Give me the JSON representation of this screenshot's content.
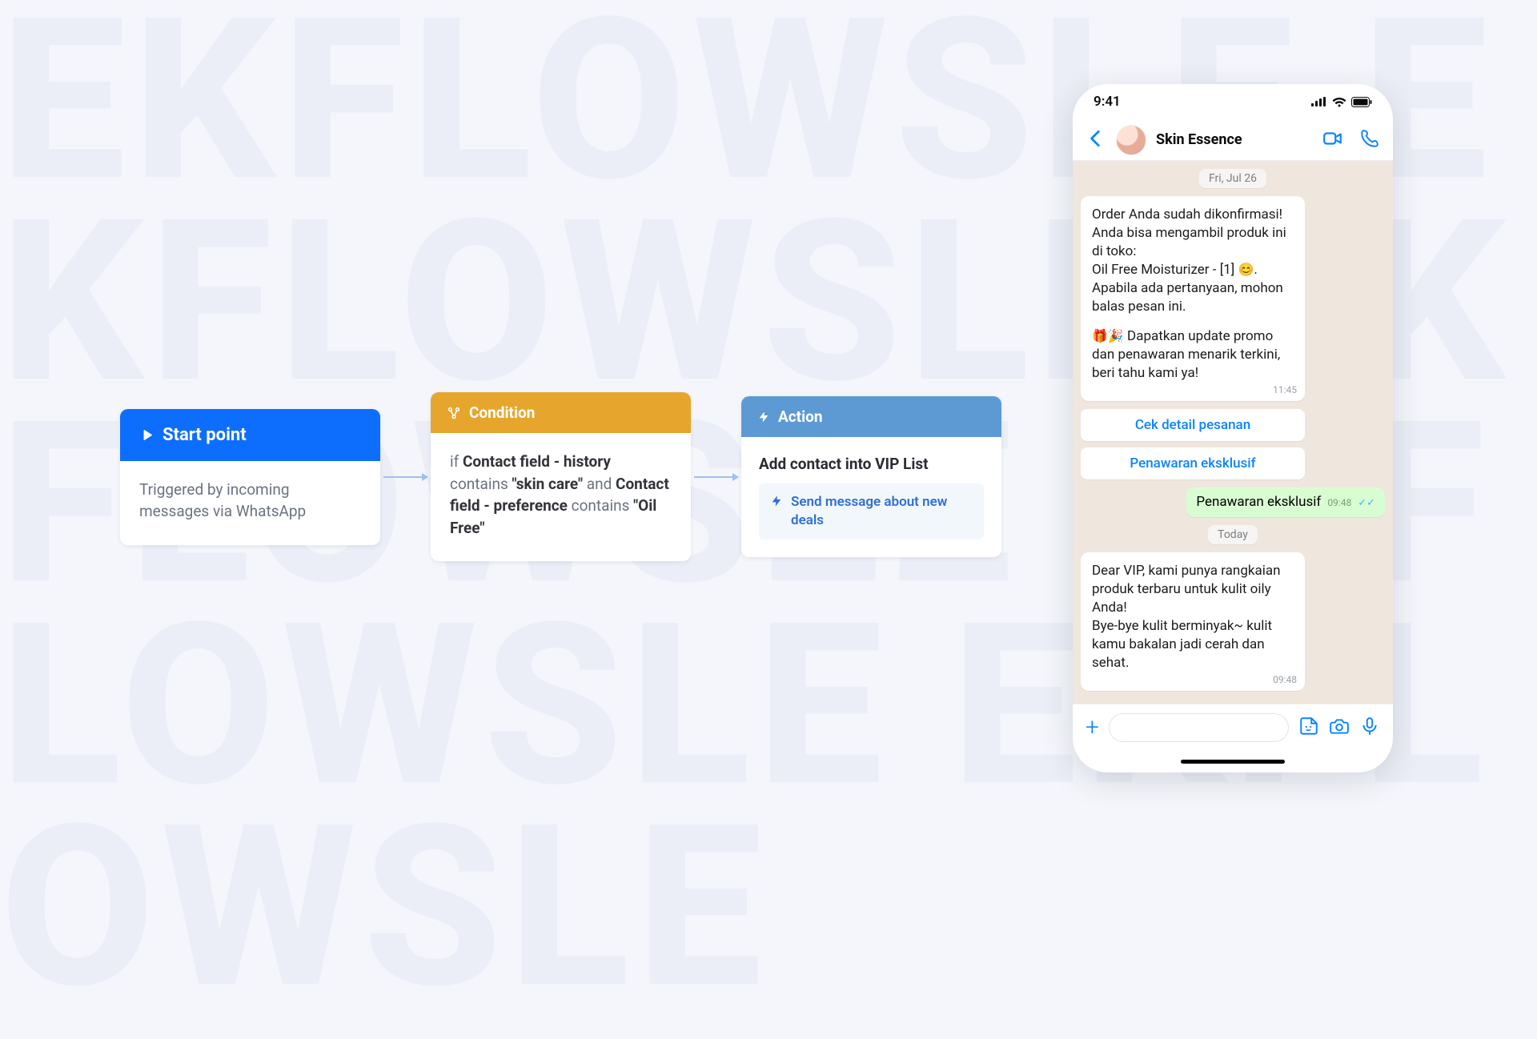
{
  "flow": {
    "start": {
      "header": "Start point",
      "body": "Triggered by incoming messages via WhatsApp"
    },
    "condition": {
      "header": "Condition",
      "pre": "if ",
      "f1": "Contact field - history",
      "mid1": " contains ",
      "v1": "\"skin care\"",
      "mid2": " and ",
      "f2": "Contact field - preference",
      "mid3": " contains ",
      "v2": "\"Oil Free\""
    },
    "action": {
      "header": "Action",
      "title": "Add contact into VIP List",
      "sub": "Send message about new deals"
    }
  },
  "phone": {
    "time": "9:41",
    "contact": "Skin Essence",
    "dates": {
      "d1": "Fri, Jul 26",
      "d2": "Today"
    },
    "msg1": {
      "l1": "Order Anda sudah dikonfirmasi! Anda bisa mengambil produk ini di toko:",
      "l2a": "Oil Free Moisturizer - [1] ",
      "l2b": ".",
      "l3": "Apabila ada pertanyaan, mohon balas pesan ini.",
      "l4a": "🎁🎉",
      "l4b": " Dapatkan update promo dan penawaran menarik terkini, beri tahu kami ya!",
      "time": "11:45"
    },
    "btn1": "Cek detail pesanan",
    "btn2": "Penawaran eksklusif",
    "out": {
      "text": "Penawaran eksklusif",
      "time": "09:48"
    },
    "msg2": {
      "l1": "Dear VIP, kami punya rangkaian produk terbaru untuk kulit oily Anda!",
      "l2": "Bye-bye kulit berminyak~ kulit kamu bakalan jadi cerah dan sehat.",
      "time": "09:48"
    }
  }
}
